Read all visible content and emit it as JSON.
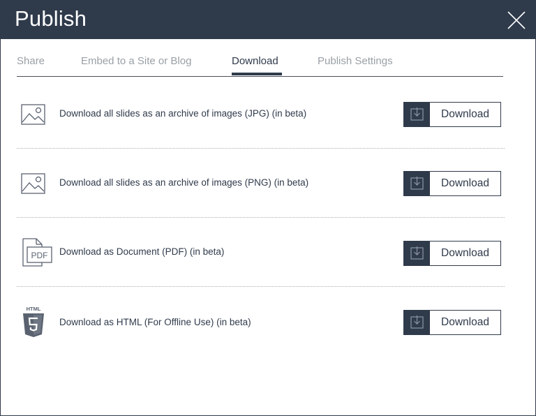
{
  "dialog": {
    "title": "Publish",
    "close_icon": "close-icon"
  },
  "tabs": [
    {
      "label": "Share"
    },
    {
      "label": "Embed to a Site or Blog"
    },
    {
      "label": "Download",
      "active": true
    },
    {
      "label": "Publish Settings"
    }
  ],
  "downloads": [
    {
      "icon": "image-icon",
      "label": "Download all slides as an archive of images (JPG) (in beta)",
      "button": "Download"
    },
    {
      "icon": "image-icon",
      "label": "Download all slides as an archive of images (PNG) (in beta)",
      "button": "Download"
    },
    {
      "icon": "pdf-document-icon",
      "label": "Download as Document (PDF) (in beta)",
      "button": "Download"
    },
    {
      "icon": "html5-icon",
      "label": "Download as HTML (For Offline Use) (in beta)",
      "button": "Download"
    }
  ],
  "colors": {
    "header_bg": "#2f3a4b",
    "tab_inactive": "#9aa0a6",
    "text": "#2f3a4b"
  }
}
